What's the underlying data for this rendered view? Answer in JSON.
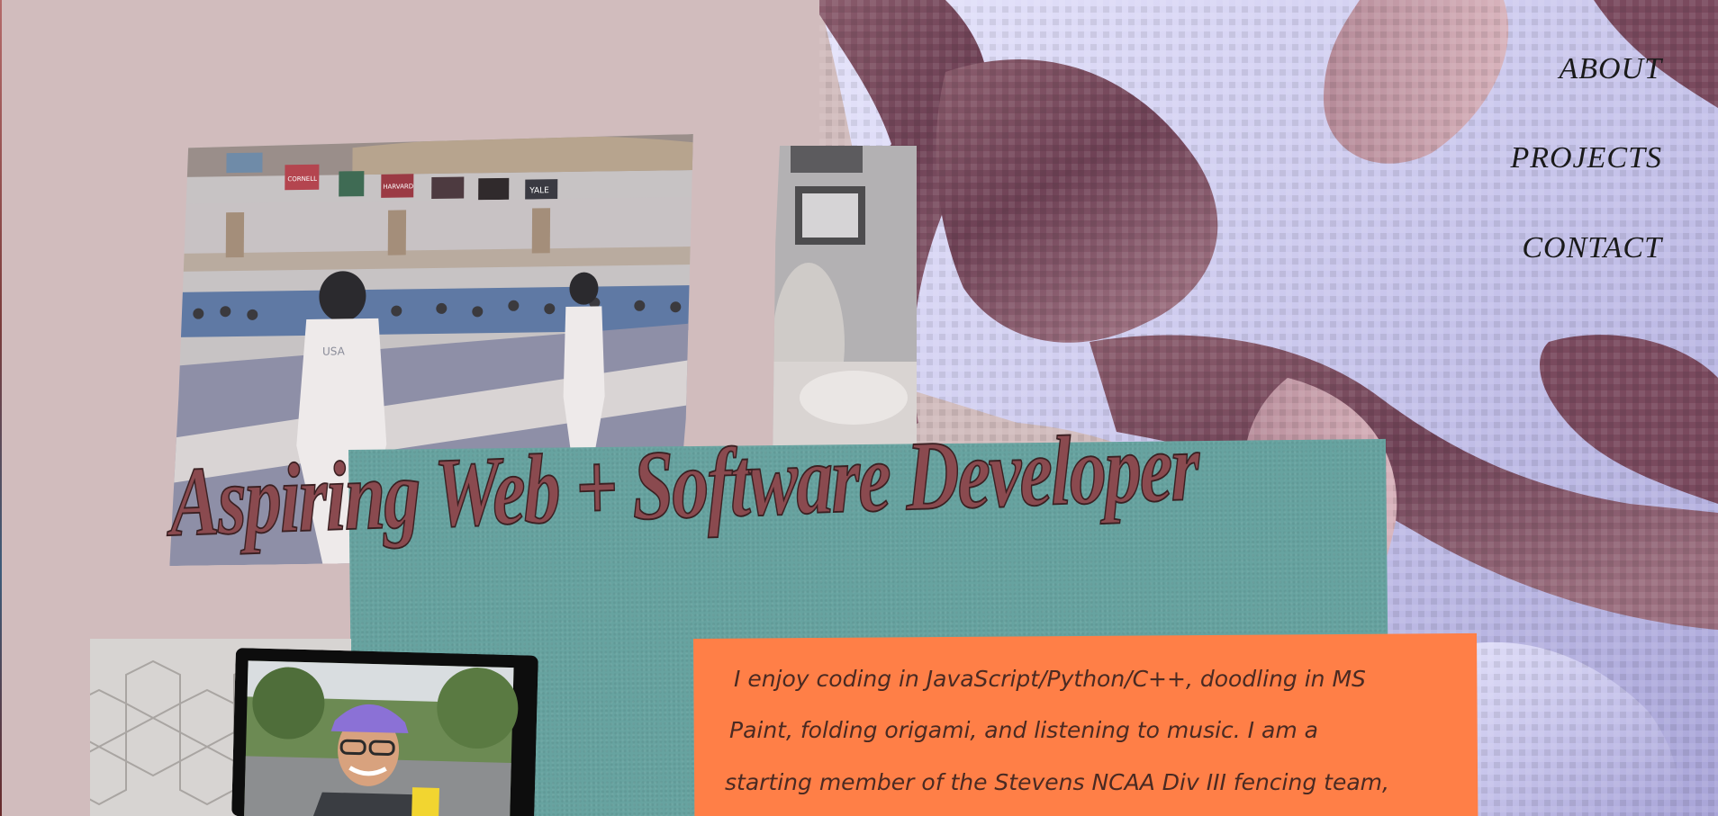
{
  "nav": {
    "about": "ABOUT",
    "projects": "PROJECTS",
    "contact": "CONTACT"
  },
  "hero": {
    "headline": "Aspiring Web + Software Developer"
  },
  "bio": {
    "line1": "I enjoy coding in JavaScript/Python/C++, doodling in MS",
    "line2": "Paint, folding origami, and listening to music. I am a",
    "line3": "starting member of the Stevens NCAA Div III fencing team,"
  },
  "photos": {
    "fencing": {
      "alt": "Fencing match in gymnasium",
      "banners": [
        "CORNELL",
        "HARVARD",
        "YALE"
      ],
      "jacket_text": "USA"
    },
    "room": {
      "alt": "Bedroom with framed photos"
    },
    "origami": {
      "alt": "White origami tessellation"
    },
    "portrait": {
      "alt": "Smiling person in purple cap"
    }
  },
  "colors": {
    "background": "#d1bcbd",
    "teal_panel": "#67a3a0",
    "bio_box": "#ff7f47",
    "headline": "#8a4a4f",
    "blob_light": "#c9c6ec",
    "blob_dark": "#7a4a5e"
  }
}
